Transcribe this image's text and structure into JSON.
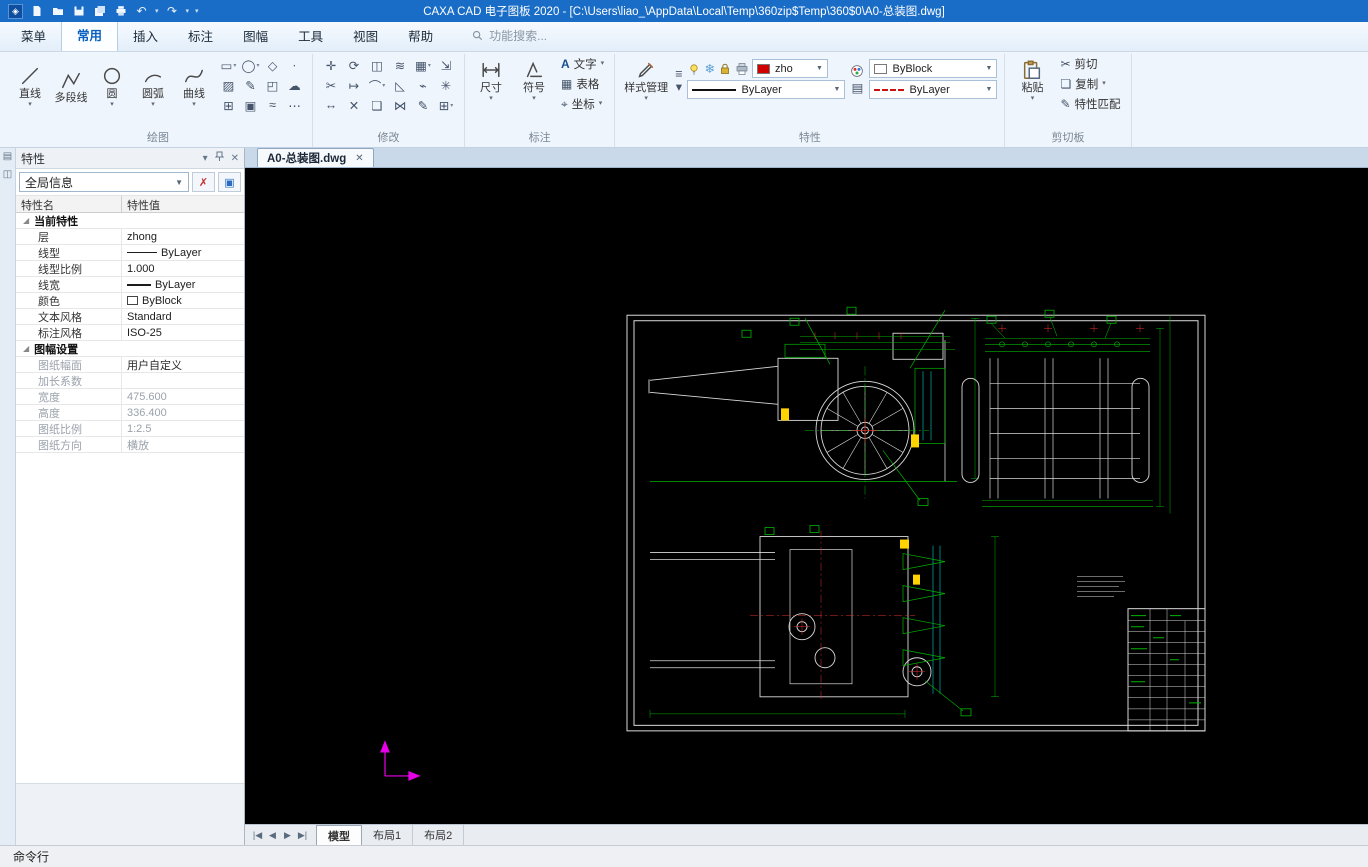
{
  "titlebar": {
    "title": "CAXA CAD 电子图板 2020 - [C:\\Users\\liao_\\AppData\\Local\\Temp\\360zip$Temp\\360$0\\A0-总装图.dwg]"
  },
  "menubar": {
    "tabs": [
      {
        "label": "菜单"
      },
      {
        "label": "常用",
        "active": true
      },
      {
        "label": "插入"
      },
      {
        "label": "标注"
      },
      {
        "label": "图幅"
      },
      {
        "label": "工具"
      },
      {
        "label": "视图"
      },
      {
        "label": "帮助"
      }
    ],
    "search_label": "功能搜索..."
  },
  "ribbon": {
    "draw": {
      "label": "绘图",
      "tools": [
        {
          "label": "直线",
          "dropdown": true
        },
        {
          "label": "多段线"
        },
        {
          "label": "圆",
          "dropdown": true
        },
        {
          "label": "圆弧",
          "dropdown": true
        },
        {
          "label": "曲线",
          "dropdown": true
        }
      ],
      "extra_icons": [
        {
          "name": "rectangle",
          "glyph": "▭",
          "dropdown": true
        },
        {
          "name": "ellipse",
          "glyph": "◯",
          "dropdown": true
        },
        {
          "name": "polygon",
          "glyph": "◇"
        },
        {
          "name": "point",
          "glyph": "∙"
        },
        {
          "name": "hatch",
          "glyph": "▨"
        },
        {
          "name": "sketch-text",
          "glyph": "✎"
        },
        {
          "name": "wipeout",
          "glyph": "◰"
        },
        {
          "name": "revision-cloud",
          "glyph": "☁"
        },
        {
          "name": "block",
          "glyph": "⊞"
        },
        {
          "name": "image",
          "glyph": "▣"
        },
        {
          "name": "spline-fit",
          "glyph": "≈"
        },
        {
          "name": "more",
          "glyph": "⋯"
        }
      ]
    },
    "modify": {
      "label": "修改",
      "icons": [
        {
          "name": "move",
          "glyph": "✛"
        },
        {
          "name": "rotate",
          "glyph": "⟳"
        },
        {
          "name": "mirror",
          "glyph": "◫"
        },
        {
          "name": "offset",
          "glyph": "≋"
        },
        {
          "name": "array",
          "glyph": "▦",
          "dropdown": true
        },
        {
          "name": "scale",
          "glyph": "⇲"
        },
        {
          "name": "trim",
          "glyph": "✂"
        },
        {
          "name": "extend",
          "glyph": "↦"
        },
        {
          "name": "fillet",
          "glyph": "⌒",
          "dropdown": true
        },
        {
          "name": "chamfer",
          "glyph": "◺"
        },
        {
          "name": "break",
          "glyph": "⌁"
        },
        {
          "name": "explode",
          "glyph": "✳"
        },
        {
          "name": "stretch",
          "glyph": "↔"
        },
        {
          "name": "erase",
          "glyph": "✕"
        },
        {
          "name": "copy-object",
          "glyph": "❏"
        },
        {
          "name": "join",
          "glyph": "⋈"
        },
        {
          "name": "edit-polyline",
          "glyph": "✎"
        },
        {
          "name": "block-editor",
          "glyph": "⊞",
          "dropdown": true
        }
      ]
    },
    "annotate": {
      "label": "标注",
      "dimension": "尺寸",
      "symbol": "符号",
      "text": "文字",
      "table": "表格",
      "coordinate": "坐标"
    },
    "properties": {
      "label": "特性",
      "style_manager": "样式管理",
      "color_value": "zho",
      "block_value": "ByBlock",
      "layer_value": "ByLayer",
      "linetype_value": "ByLayer"
    },
    "clipboard": {
      "label": "剪切板",
      "paste": "粘贴",
      "cut": "剪切",
      "copy": "复制",
      "match": "特性匹配"
    }
  },
  "sidebar": {
    "title": "特性",
    "scope": "全局信息",
    "columns": [
      "特性名",
      "特性值"
    ],
    "rows": [
      {
        "type": "group",
        "name": "当前特性"
      },
      {
        "type": "prop",
        "name": "层",
        "value": "zhong"
      },
      {
        "type": "line",
        "name": "线型",
        "value": "ByLayer"
      },
      {
        "type": "prop",
        "name": "线型比例",
        "value": "1.000"
      },
      {
        "type": "line2",
        "name": "线宽",
        "value": "ByLayer"
      },
      {
        "type": "swatch",
        "name": "颜色",
        "value": "ByBlock"
      },
      {
        "type": "prop",
        "name": "文本风格",
        "value": "Standard"
      },
      {
        "type": "prop",
        "name": "标注风格",
        "value": "ISO-25"
      },
      {
        "type": "group",
        "name": "图幅设置"
      },
      {
        "type": "prop",
        "name": "图纸幅面",
        "value": "用户自定义",
        "dim": true,
        "vdark": true
      },
      {
        "type": "prop",
        "name": "加长系数",
        "value": "",
        "dim": true
      },
      {
        "type": "prop",
        "name": "宽度",
        "value": "475.600",
        "dim": true
      },
      {
        "type": "prop",
        "name": "高度",
        "value": "336.400",
        "dim": true
      },
      {
        "type": "prop",
        "name": "图纸比例",
        "value": "1:2.5",
        "dim": true
      },
      {
        "type": "prop",
        "name": "图纸方向",
        "value": "横放",
        "dim": true
      }
    ]
  },
  "document": {
    "tab_label": "A0-总装图.dwg",
    "close": "✕"
  },
  "canvas_nav": {
    "buttons": [
      "|◀",
      "◀",
      "▶",
      "▶|"
    ],
    "tabs": [
      {
        "label": "模型",
        "active": true
      },
      {
        "label": "布局1"
      },
      {
        "label": "布局2"
      }
    ]
  },
  "statusbar": {
    "label": "命令行"
  },
  "colors": {
    "titlebar": "#1a6dc7",
    "accent_blue": "#0a62c0",
    "canvas_bg": "#000000",
    "drawing_white": "#d9d9d9",
    "drawing_green": "#00b400",
    "drawing_red": "#e03030",
    "drawing_cyan": "#00cccc",
    "drawing_magenta": "#e800e8",
    "highlight_yellow": "#ffd400",
    "color_swatch_red": "#d00000"
  }
}
